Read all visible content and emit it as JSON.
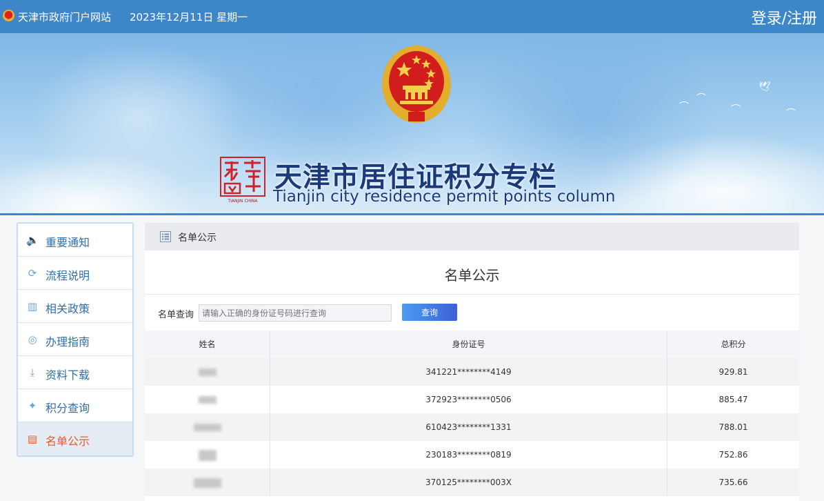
{
  "topbar": {
    "site_name": "天津市政府门户网站",
    "date": "2023年12月11日 星期一",
    "login": "登录/注册"
  },
  "banner": {
    "title": "天津市居住证积分专栏",
    "subtitle": "Tianjin city residence permit points column",
    "seal_text": "TIANJIN CHINA"
  },
  "sidebar": {
    "items": [
      {
        "label": "重要通知",
        "icon": "speaker-icon"
      },
      {
        "label": "流程说明",
        "icon": "flow-icon"
      },
      {
        "label": "相关政策",
        "icon": "book-icon"
      },
      {
        "label": "办理指南",
        "icon": "compass-icon"
      },
      {
        "label": "资料下载",
        "icon": "download-icon"
      },
      {
        "label": "积分查询",
        "icon": "search-points-icon"
      },
      {
        "label": "名单公示",
        "icon": "list-box-icon"
      }
    ],
    "active_index": 6
  },
  "main": {
    "breadcrumb": "名单公示",
    "title": "名单公示",
    "query_label": "名单查询",
    "query_placeholder": "请输入正确的身份证号码进行查询",
    "query_button": "查询",
    "table": {
      "headers": [
        "姓名",
        "身份证号",
        "总积分"
      ],
      "rows": [
        {
          "id": "341221********4149",
          "score": "929.81"
        },
        {
          "id": "372923********0506",
          "score": "885.47"
        },
        {
          "id": "610423********1331",
          "score": "788.01"
        },
        {
          "id": "230183********0819",
          "score": "752.86"
        },
        {
          "id": "370125********003X",
          "score": "735.66"
        }
      ]
    }
  },
  "colors": {
    "topbar": "#3d86c8",
    "active_item": "#e45b2c",
    "nav_text": "#2d6fa8"
  }
}
